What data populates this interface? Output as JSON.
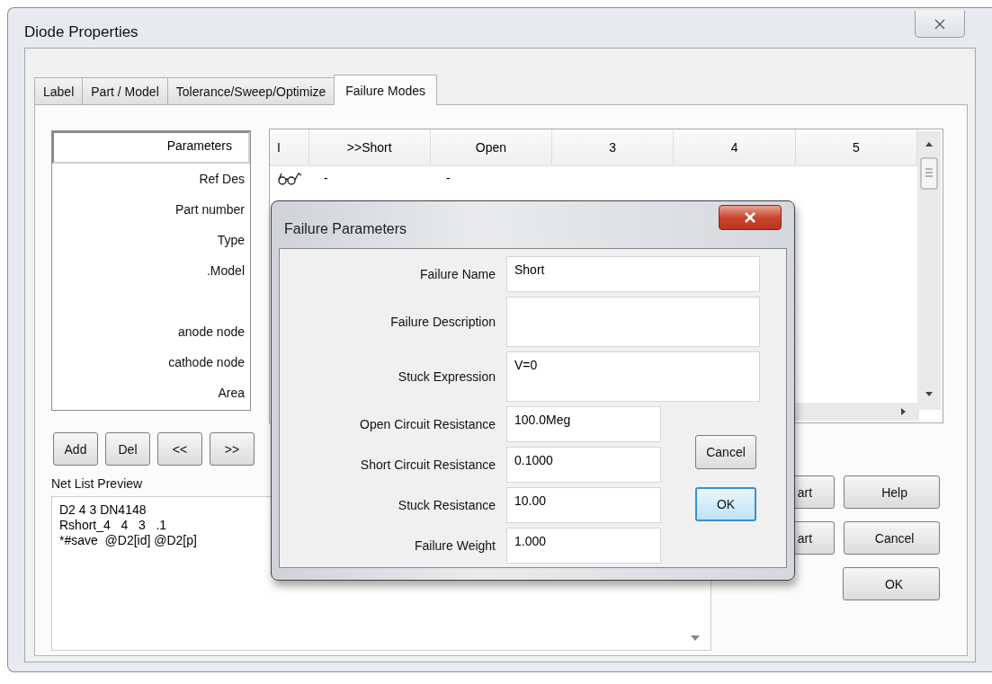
{
  "window": {
    "title": "Diode Properties"
  },
  "tabs": [
    {
      "label": "Label",
      "selected": false
    },
    {
      "label": "Part / Model",
      "selected": false
    },
    {
      "label": "Tolerance/Sweep/Optimize",
      "selected": false
    },
    {
      "label": "Failure Modes",
      "selected": true
    }
  ],
  "parameters": {
    "header": "Parameters",
    "items": [
      "Ref Des",
      "Part number",
      "Type",
      ".Model",
      "anode node",
      "cathode node",
      "Area"
    ]
  },
  "failure_table": {
    "columns": [
      "I",
      ">>Short",
      "Open",
      "3",
      "4",
      "5"
    ],
    "rows": [
      {
        "cells": [
          "-",
          "-"
        ]
      }
    ]
  },
  "list_buttons": [
    "Add",
    "Del",
    "<<",
    ">>"
  ],
  "net_list_preview": {
    "label": "Net List Preview",
    "lines": [
      "D2 4 3 DN4148",
      "Rshort_4   4   3   .1",
      "*#save  @D2[id] @D2[p]"
    ]
  },
  "side_buttons": [
    [
      "art",
      "Help"
    ],
    [
      "art",
      "Cancel"
    ],
    [
      "OK"
    ]
  ],
  "dialog": {
    "title": "Failure Parameters",
    "fields": [
      {
        "label": "Failure Name",
        "value": "Short",
        "kind": "single"
      },
      {
        "label": "Failure Description",
        "kind": "multiline"
      },
      {
        "label": "Stuck Expression",
        "value": "V=0",
        "kind": "multiline"
      },
      {
        "label": "Open Circuit Resistance",
        "value": "100.0Meg",
        "kind": "narrow"
      },
      {
        "label": "Short Circuit Resistance",
        "value": "0.1000",
        "kind": "narrow"
      },
      {
        "label": "Stuck Resistance",
        "value": "10.00",
        "kind": "narrow"
      },
      {
        "label": "Failure Weight",
        "value": "1.000",
        "kind": "narrow"
      }
    ],
    "buttons": [
      {
        "label": "Cancel",
        "default": false
      },
      {
        "label": "OK",
        "default": true
      }
    ]
  }
}
